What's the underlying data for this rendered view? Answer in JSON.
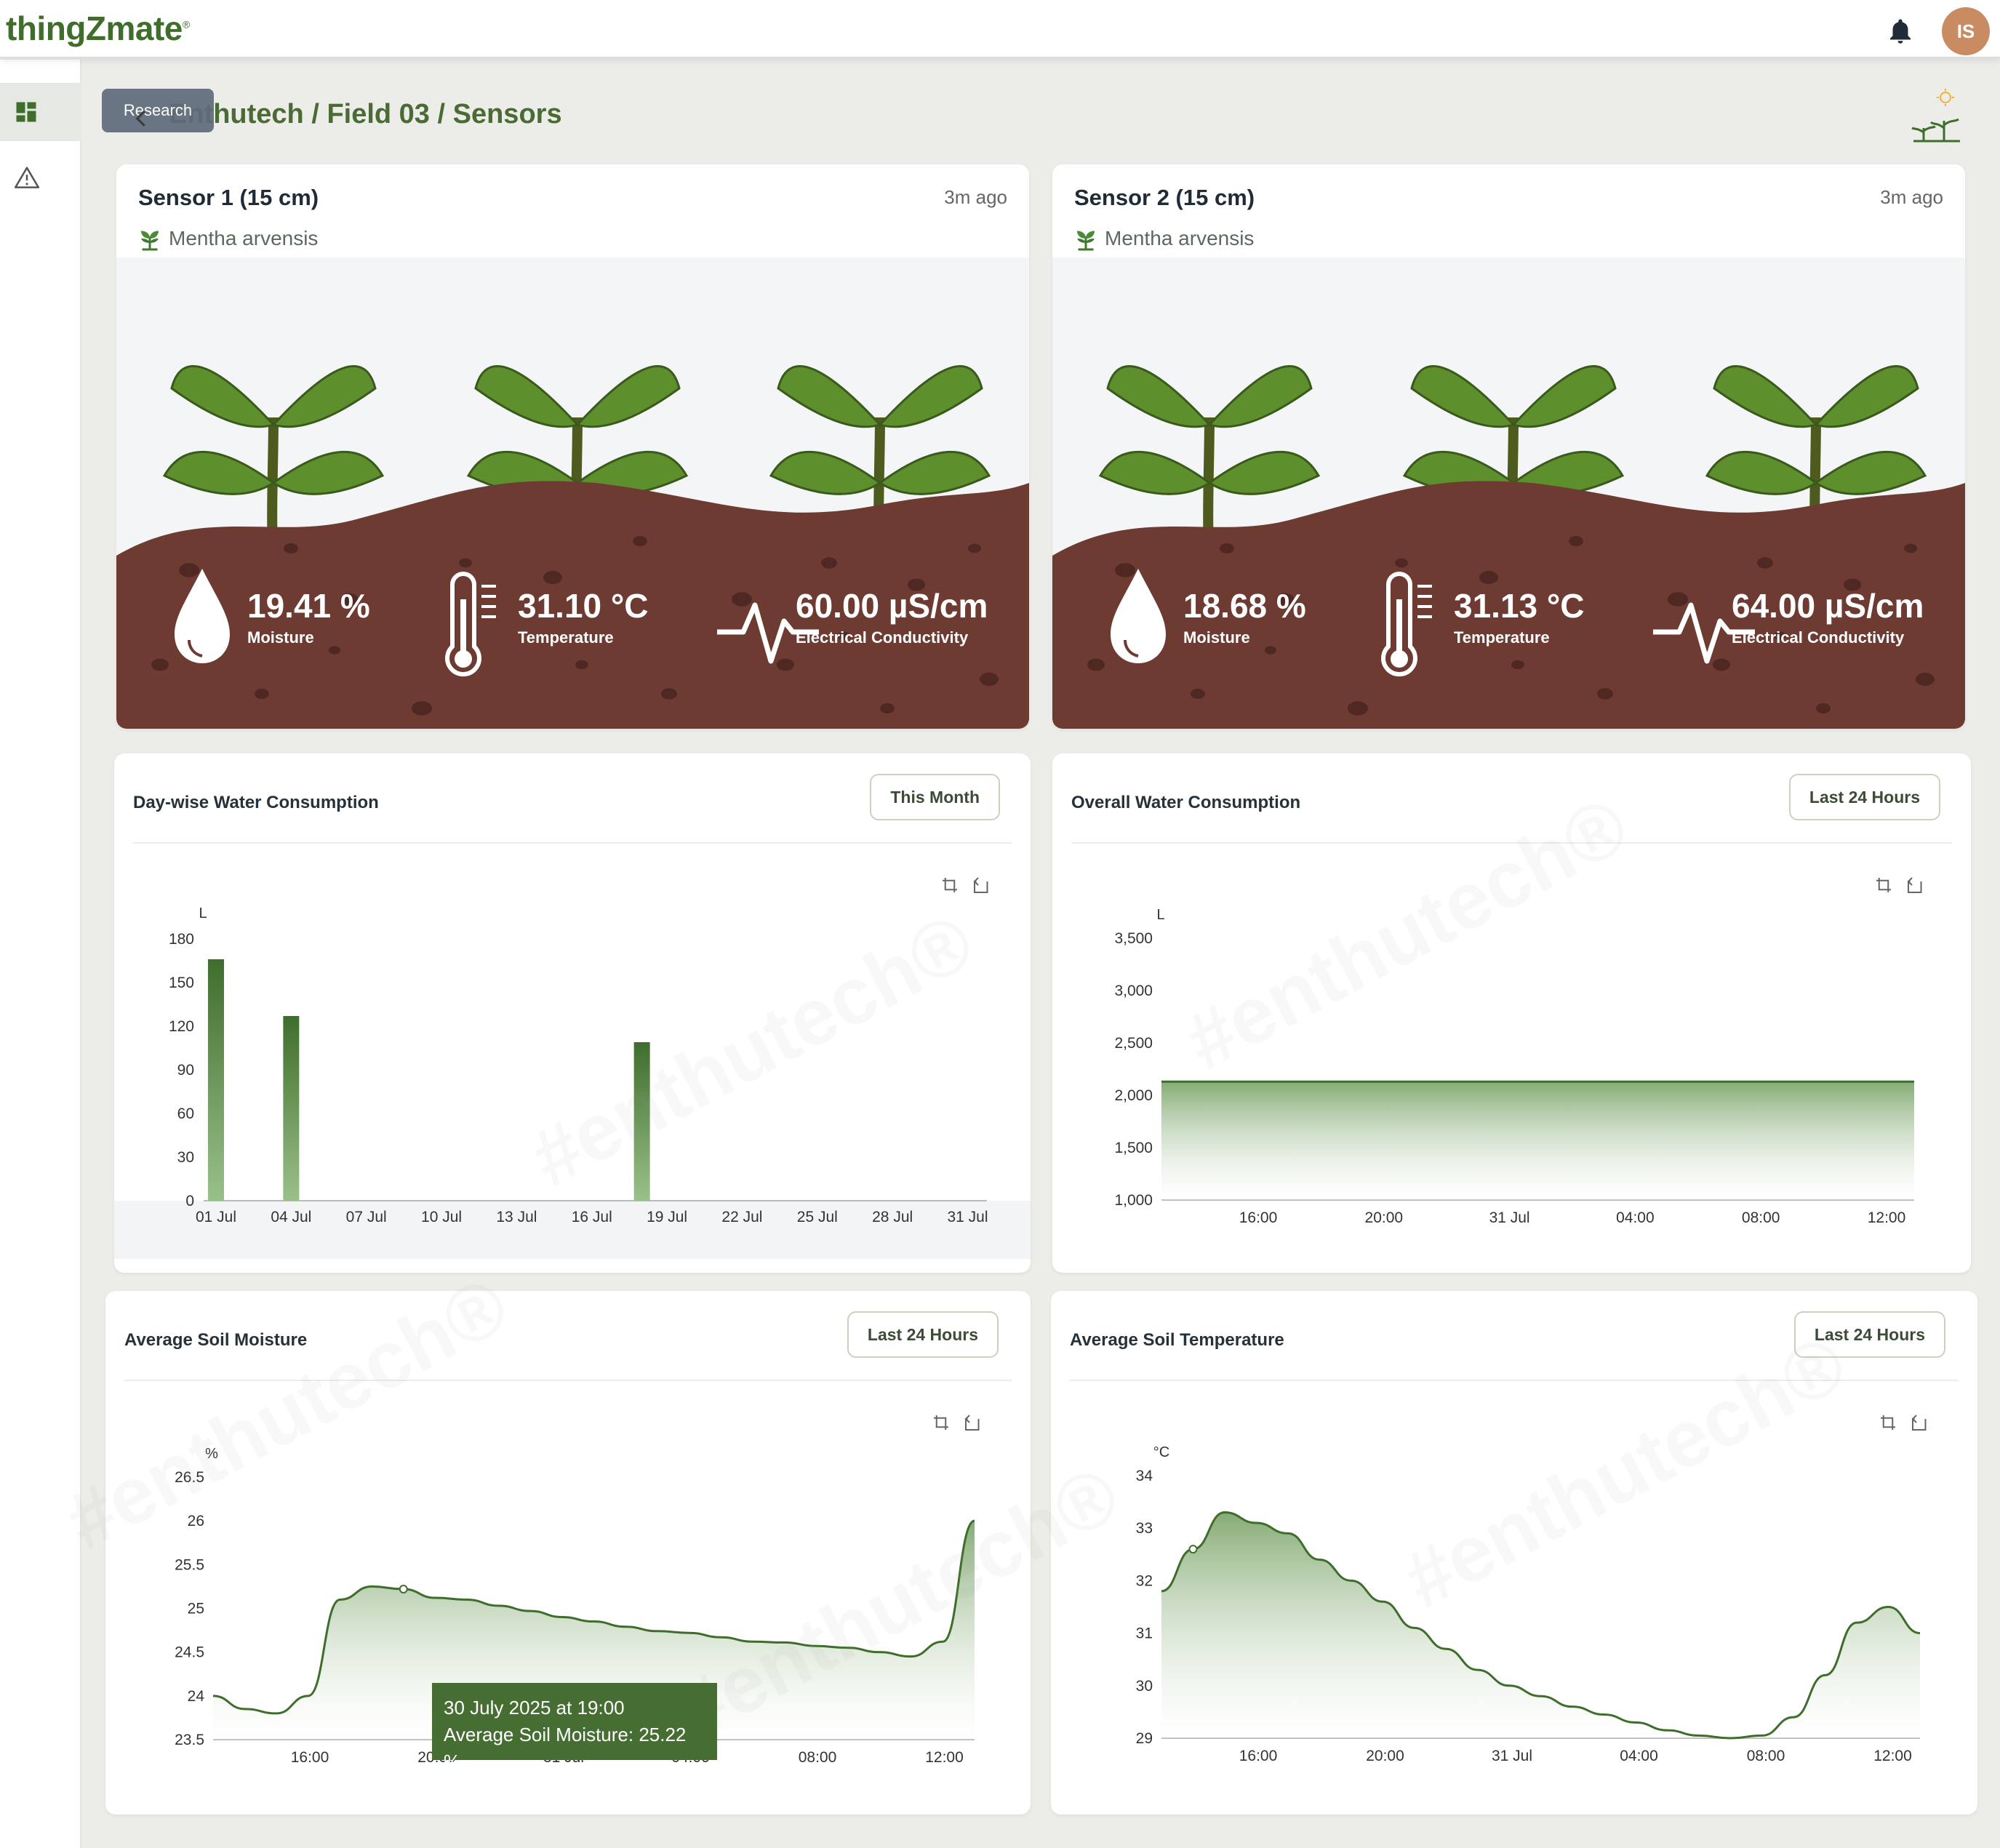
{
  "app": {
    "logo": "thingZmate",
    "logo_mark": "®",
    "user_initials": "IS"
  },
  "nav": {
    "research_label": "Research",
    "breadcrumb": "Enthutech / Field 03 / Sensors"
  },
  "watermark_text": "#enthutech®",
  "sensors": [
    {
      "title": "Sensor 1 (15 cm)",
      "updated": "3m ago",
      "crop": "Mentha arvensis",
      "moisture": {
        "value": "19.41 %",
        "label": "Moisture"
      },
      "temperature": {
        "value": "31.10 °C",
        "label": "Temperature"
      },
      "ec": {
        "value": "60.00 µS/cm",
        "label": "Electrical Conductivity"
      }
    },
    {
      "title": "Sensor 2 (15 cm)",
      "updated": "3m ago",
      "crop": "Mentha arvensis",
      "moisture": {
        "value": "18.68 %",
        "label": "Moisture"
      },
      "temperature": {
        "value": "31.13 °C",
        "label": "Temperature"
      },
      "ec": {
        "value": "64.00 µS/cm",
        "label": "Electrical Conductivity"
      }
    }
  ],
  "charts": {
    "daywise": {
      "title": "Day-wise Water Consumption",
      "range": "This Month"
    },
    "overall": {
      "title": "Overall Water Consumption",
      "range": "Last 24 Hours"
    },
    "moisture": {
      "title": "Average Soil Moisture",
      "range": "Last 24 Hours"
    },
    "temperature": {
      "title": "Average Soil Temperature",
      "range": "Last 24 Hours"
    }
  },
  "tooltip": {
    "line1": "30 July 2025 at 19:00",
    "line2": "Average Soil Moisture: 25.22 %"
  },
  "colors": {
    "brand": "#3f6e2c",
    "soil": "#6e3b33",
    "accent": "#4a7a32",
    "avatar": "#c98b62"
  },
  "chart_data": [
    {
      "type": "bar",
      "title": "Day-wise Water Consumption",
      "ylabel": "L",
      "categories": [
        "01 Jul",
        "02 Jul",
        "03 Jul",
        "04 Jul",
        "05 Jul",
        "06 Jul",
        "07 Jul",
        "08 Jul",
        "09 Jul",
        "10 Jul",
        "11 Jul",
        "12 Jul",
        "13 Jul",
        "14 Jul",
        "15 Jul",
        "16 Jul",
        "17 Jul",
        "18 Jul",
        "19 Jul",
        "20 Jul",
        "21 Jul",
        "22 Jul",
        "23 Jul",
        "24 Jul",
        "25 Jul",
        "26 Jul",
        "27 Jul",
        "28 Jul",
        "29 Jul",
        "30 Jul",
        "31 Jul"
      ],
      "xticks": [
        "01 Jul",
        "04 Jul",
        "07 Jul",
        "10 Jul",
        "13 Jul",
        "16 Jul",
        "19 Jul",
        "22 Jul",
        "25 Jul",
        "28 Jul",
        "31 Jul"
      ],
      "values": [
        166,
        0,
        0,
        127,
        0,
        0,
        0,
        0,
        0,
        0,
        0,
        0,
        0,
        0,
        0,
        0,
        0,
        109,
        0,
        0,
        0,
        0,
        0,
        0,
        0,
        0,
        0,
        0,
        0,
        0,
        0
      ],
      "yticks": [
        0,
        30,
        60,
        90,
        120,
        150,
        180
      ],
      "ylim": [
        0,
        180
      ]
    },
    {
      "type": "area",
      "title": "Overall Water Consumption",
      "ylabel": "L",
      "x": [
        "13:00",
        "14:00",
        "15:00",
        "16:00",
        "17:00",
        "18:00",
        "19:00",
        "20:00",
        "21:00",
        "22:00",
        "23:00",
        "00:00",
        "01:00",
        "02:00",
        "03:00",
        "04:00",
        "05:00",
        "06:00",
        "07:00",
        "08:00",
        "09:00",
        "10:00",
        "11:00",
        "12:00",
        "13:00"
      ],
      "values": [
        2130,
        2130,
        2130,
        2130,
        2130,
        2130,
        2130,
        2130,
        2130,
        2130,
        2130,
        2130,
        2130,
        2130,
        2130,
        2130,
        2130,
        2130,
        2130,
        2130,
        2130,
        2130,
        2130,
        2130,
        2130
      ],
      "xticks": [
        "16:00",
        "20:00",
        "31 Jul",
        "04:00",
        "08:00",
        "12:00"
      ],
      "yticks": [
        "1,000",
        "1,500",
        "2,000",
        "2,500",
        "3,000",
        "3,500"
      ],
      "ylim": [
        1000,
        3500
      ]
    },
    {
      "type": "area",
      "title": "Average Soil Moisture",
      "ylabel": "%",
      "x": [
        "13:00",
        "14:00",
        "15:00",
        "16:00",
        "17:00",
        "18:00",
        "19:00",
        "20:00",
        "21:00",
        "22:00",
        "23:00",
        "00:00",
        "01:00",
        "02:00",
        "03:00",
        "04:00",
        "05:00",
        "06:00",
        "07:00",
        "08:00",
        "09:00",
        "10:00",
        "11:00",
        "12:00",
        "13:00"
      ],
      "values": [
        24.0,
        23.85,
        23.8,
        24.0,
        25.1,
        25.25,
        25.22,
        25.12,
        25.1,
        25.03,
        24.97,
        24.9,
        24.85,
        24.79,
        24.74,
        24.72,
        24.67,
        24.62,
        24.61,
        24.57,
        24.55,
        24.5,
        24.45,
        24.62,
        26.0
      ],
      "xticks": [
        "16:00",
        "20:00",
        "31 Jul",
        "04:00",
        "08:00",
        "12:00"
      ],
      "yticks": [
        "23.5",
        "24",
        "24.5",
        "25",
        "25.5",
        "26",
        "26.5"
      ],
      "ylim": [
        23.5,
        26.5
      ]
    },
    {
      "type": "area",
      "title": "Average Soil Temperature",
      "ylabel": "°C",
      "x": [
        "13:00",
        "14:00",
        "15:00",
        "16:00",
        "17:00",
        "18:00",
        "19:00",
        "20:00",
        "21:00",
        "22:00",
        "23:00",
        "00:00",
        "01:00",
        "02:00",
        "03:00",
        "04:00",
        "05:00",
        "06:00",
        "07:00",
        "08:00",
        "09:00",
        "10:00",
        "11:00",
        "12:00",
        "13:00"
      ],
      "values": [
        31.8,
        32.6,
        33.3,
        33.1,
        32.9,
        32.4,
        32.0,
        31.6,
        31.1,
        30.7,
        30.3,
        30.0,
        29.8,
        29.6,
        29.45,
        29.3,
        29.15,
        29.05,
        29.0,
        29.05,
        29.4,
        30.2,
        31.2,
        31.5,
        31.0
      ],
      "xticks": [
        "16:00",
        "20:00",
        "31 Jul",
        "04:00",
        "08:00",
        "12:00"
      ],
      "yticks": [
        "29",
        "30",
        "31",
        "32",
        "33",
        "34"
      ],
      "ylim": [
        29,
        34
      ]
    }
  ]
}
